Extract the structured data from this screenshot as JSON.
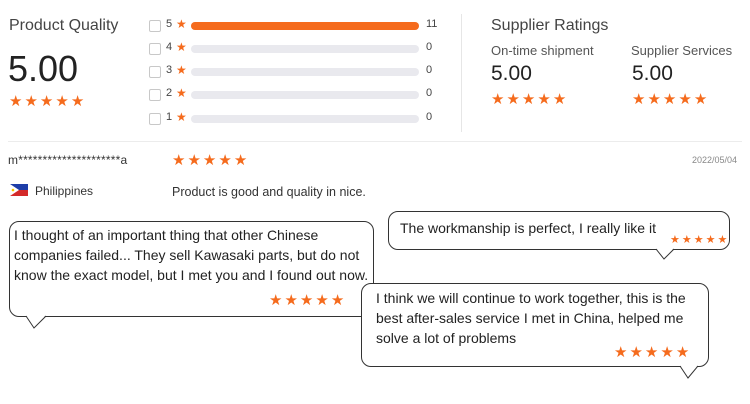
{
  "product_quality": {
    "title": "Product Quality",
    "score": "5.00",
    "stars": 5,
    "distribution": [
      {
        "stars": "5",
        "count": "11",
        "fraction": 1.0
      },
      {
        "stars": "4",
        "count": "0",
        "fraction": 0
      },
      {
        "stars": "3",
        "count": "0",
        "fraction": 0
      },
      {
        "stars": "2",
        "count": "0",
        "fraction": 0
      },
      {
        "stars": "1",
        "count": "0",
        "fraction": 0
      }
    ]
  },
  "supplier_ratings": {
    "title": "Supplier Ratings",
    "on_time": {
      "label": "On-time shipment",
      "score": "5.00",
      "stars": 5
    },
    "services": {
      "label": "Supplier Services",
      "score": "5.00",
      "stars": 5
    }
  },
  "review": {
    "reviewer": "m*********************a",
    "stars": 5,
    "date": "2022/05/04",
    "country": "Philippines",
    "flag": "philippines-flag",
    "text": "Product is good and quality in nice."
  },
  "bubbles": [
    {
      "text": "I thought of an important thing that other Chinese companies failed... They sell Kawasaki parts, but do not know the exact model, but I met you and I found out now.",
      "stars": 5
    },
    {
      "text": "The workmanship is perfect, I really like it",
      "stars": 5
    },
    {
      "text": "I think we will continue to work together, this is the best after-sales service I met in China, helped me solve a lot of problems",
      "stars": 5
    }
  ],
  "colors": {
    "accent": "#f56b1d",
    "track": "#e9e9ee"
  }
}
